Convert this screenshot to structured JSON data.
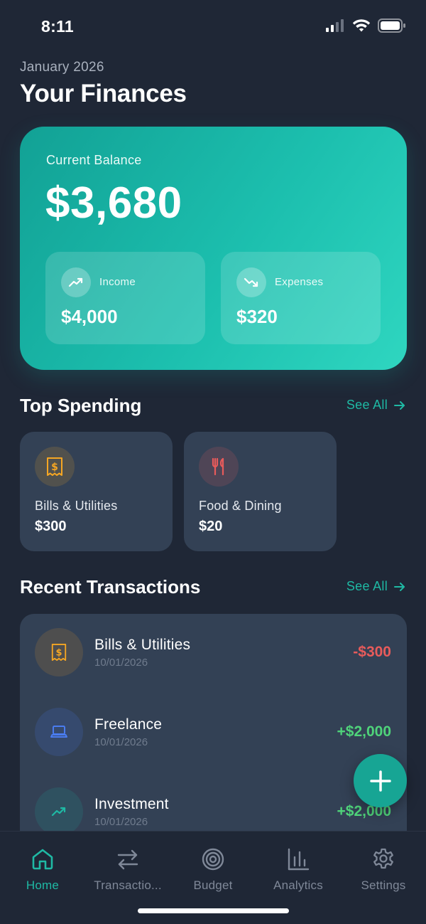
{
  "status_bar": {
    "time": "8:11"
  },
  "header": {
    "date": "January 2026",
    "title": "Your Finances"
  },
  "balance_card": {
    "label": "Current Balance",
    "amount": "$3,680",
    "income": {
      "label": "Income",
      "value": "$4,000",
      "icon": "trending-up-icon"
    },
    "expenses": {
      "label": "Expenses",
      "value": "$320",
      "icon": "trending-down-icon"
    }
  },
  "top_spending": {
    "title": "Top Spending",
    "see_all": "See All",
    "items": [
      {
        "name": "Bills & Utilities",
        "amount": "$300",
        "icon": "bill-icon",
        "color": "#f5a623"
      },
      {
        "name": "Food & Dining",
        "amount": "$20",
        "icon": "fork-knife-icon",
        "color": "#e85b5b"
      }
    ]
  },
  "recent_transactions": {
    "title": "Recent Transactions",
    "see_all": "See All",
    "items": [
      {
        "name": "Bills & Utilities",
        "date": "10/01/2026",
        "amount": "-$300",
        "icon": "bill-icon",
        "color": "#f5a623"
      },
      {
        "name": "Freelance",
        "date": "10/01/2026",
        "amount": "+$2,000",
        "icon": "laptop-icon",
        "color": "#4a7cf0"
      },
      {
        "name": "Investment",
        "date": "10/01/2026",
        "amount": "+$2,000",
        "icon": "trending-up-icon",
        "color": "#1fb9a4"
      }
    ]
  },
  "colors": {
    "accent": "#1fb9a4",
    "negative": "#e85b5b",
    "positive": "#4fd37a",
    "background": "#1f2736",
    "card": "#334155"
  },
  "tab_bar": {
    "items": [
      {
        "label": "Home",
        "icon": "home-icon",
        "active": true
      },
      {
        "label": "Transactio...",
        "icon": "transfer-icon",
        "active": false
      },
      {
        "label": "Budget",
        "icon": "target-icon",
        "active": false
      },
      {
        "label": "Analytics",
        "icon": "bar-chart-icon",
        "active": false
      },
      {
        "label": "Settings",
        "icon": "gear-icon",
        "active": false
      }
    ]
  }
}
